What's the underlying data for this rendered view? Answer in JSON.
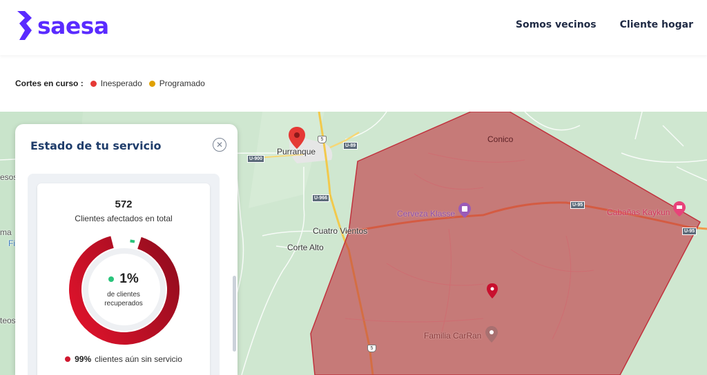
{
  "header": {
    "brand": "saesa",
    "nav": [
      {
        "label": "Somos vecinos"
      },
      {
        "label": "Cliente hogar"
      }
    ]
  },
  "legend": {
    "title": "Cortes en curso :",
    "items": [
      {
        "label": "Inesperado",
        "color": "#e53935"
      },
      {
        "label": "Programado",
        "color": "#e0a100"
      }
    ]
  },
  "map": {
    "places": {
      "purranque": "Purranque",
      "conico": "Conico",
      "cuatro_vientos": "Cuatro Vientos",
      "corte_alto": "Corte Alto"
    },
    "pois": {
      "cerveza": "Cerveza Klasse",
      "cabanas": "Cabañas Kaykun",
      "familia": "Familia CarRan"
    },
    "roads": {
      "u89": "U-89",
      "u900": "U-900",
      "u966": "U-966",
      "u95a": "U-95",
      "u95b": "U-95",
      "r5a": "5",
      "r5b": "5"
    },
    "edge_fragments": [
      "esos",
      "ma",
      "Fi",
      "teos"
    ],
    "outage_color": "#c0323d"
  },
  "panel": {
    "title": "Estado de tu servicio",
    "total_clients": "572",
    "total_label": "Clientes afectados en total",
    "recovered_pct": "1%",
    "recovered_fraction": 0.01,
    "recovered_label_1": "de clientes",
    "recovered_label_2": "recuperados",
    "without_service_pct": "99%",
    "without_service_label": "clientes aún sin servicio"
  }
}
